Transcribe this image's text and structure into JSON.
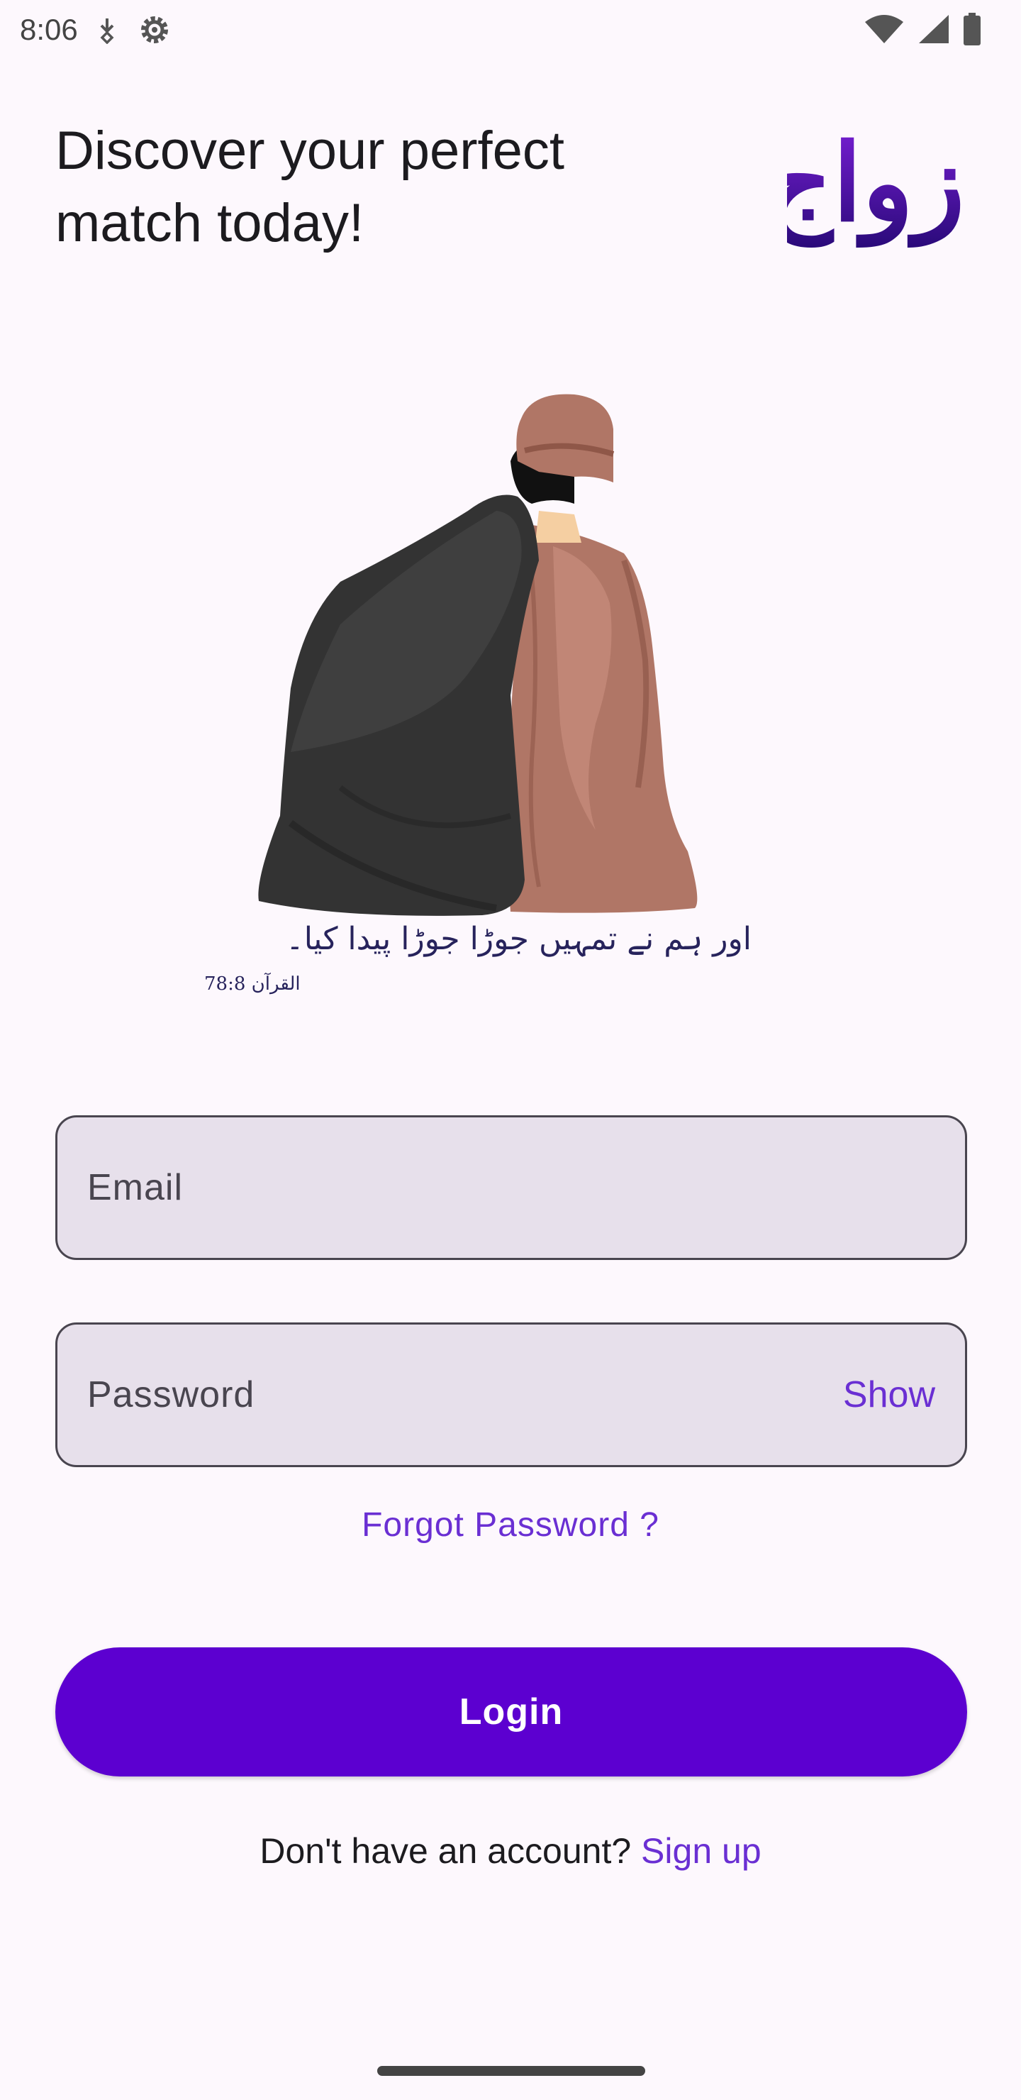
{
  "status_bar": {
    "time": "8:06"
  },
  "header": {
    "headline_line1": "Discover your perfect",
    "headline_line2": "match today!",
    "logo_text": "ازواج"
  },
  "illustration": {
    "verse": "اور ہم نے تمہیں جوڑا جوڑا پیدا کیا۔",
    "verse_ref": "القرآن 78:8"
  },
  "form": {
    "email_placeholder": "Email",
    "password_placeholder": "Password",
    "show_label": "Show",
    "forgot_label": "Forgot Password ?",
    "login_label": "Login",
    "signup_prompt": "Don't have an account? ",
    "signup_label": "Sign up"
  },
  "colors": {
    "accent": "#6a2fd3",
    "primary_button": "#5c00d0",
    "field_background": "#e7e0eb",
    "background": "#fdf8fd"
  },
  "icons": [
    "download-status-icon",
    "settings-gear-icon",
    "wifi-icon",
    "cellular-signal-icon",
    "battery-icon"
  ]
}
